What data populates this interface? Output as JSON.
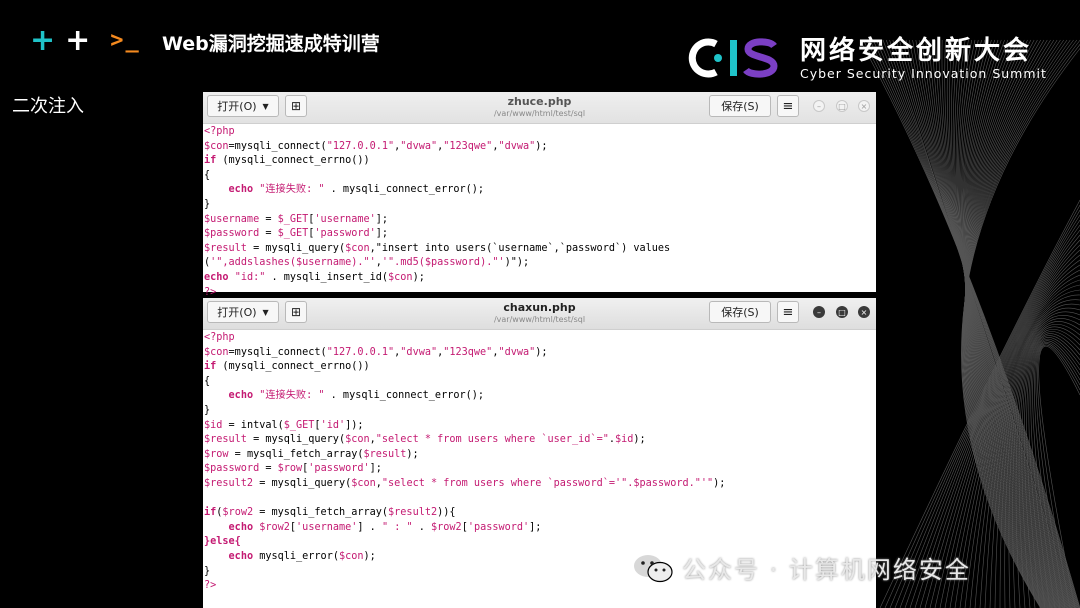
{
  "header": {
    "course_title": "Web漏洞挖掘速成特训营",
    "icons": [
      "plus-icon",
      "plus-icon",
      "terminal-prompt-icon"
    ],
    "prompt_glyph": ">_"
  },
  "logo": {
    "mark": "CIS",
    "name_cn": "网络安全创新大会",
    "name_en": "Cyber Security Innovation Summit",
    "colors": {
      "c": "#ffffff",
      "i": "#1fc3c9",
      "s": "#7b3fc4"
    }
  },
  "section_label": "二次注入",
  "editor1": {
    "open_label": "打开(O)",
    "save_label": "保存(S)",
    "filename": "zhuce.php",
    "path": "/var/www/html/test/sql",
    "code": [
      "<?php",
      "$con=mysqli_connect(\"127.0.0.1\",\"dvwa\",\"123qwe\",\"dvwa\");",
      "if (mysqli_connect_errno())",
      "{",
      "    echo \"连接失败: \" . mysqli_connect_error();",
      "}",
      "$username = $_GET['username'];",
      "$password = $_GET['password'];",
      "$result = mysqli_query($con,\"insert into users(`username`,`password`) values",
      "('\",addslashes($username).\"','\".md5($password).\"')\");",
      "echo \"id:\" . mysqli_insert_id($con);",
      "?>"
    ]
  },
  "editor2": {
    "open_label": "打开(O)",
    "save_label": "保存(S)",
    "filename": "chaxun.php",
    "path": "/var/www/html/test/sql",
    "code": [
      "<?php",
      "$con=mysqli_connect(\"127.0.0.1\",\"dvwa\",\"123qwe\",\"dvwa\");",
      "if (mysqli_connect_errno())",
      "{",
      "    echo \"连接失败: \" . mysqli_connect_error();",
      "}",
      "$id = intval($_GET['id']);",
      "$result = mysqli_query($con,\"select * from users where `user_id`=\".$id);",
      "$row = mysqli_fetch_array($result);",
      "$password = $row['password'];",
      "$result2 = mysqli_query($con,\"select * from users where `password`='\".$password.\"'\");",
      "",
      "if($row2 = mysqli_fetch_array($result2)){",
      "    echo $row2['username'] . \" : \" . $row2['password'];",
      "}else{",
      "    echo mysqli_error($con);",
      "}",
      "?>"
    ]
  },
  "watermark": {
    "text": "公众号 · 计算机网络安全"
  },
  "colors": {
    "accent_teal": "#1fc3c9",
    "accent_orange": "#f58a1f",
    "code_keyword": "#c41a72"
  }
}
